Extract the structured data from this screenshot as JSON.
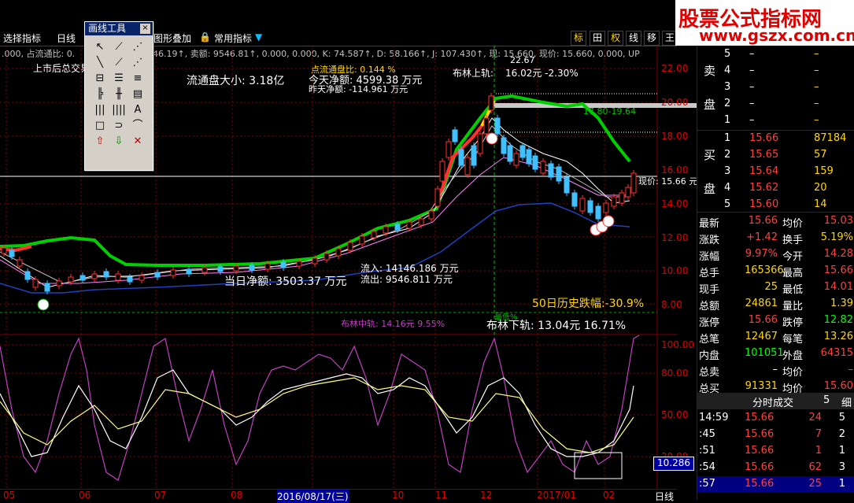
{
  "info_bar": {
    "text": ".000, 占流通比: 0.",
    "text2": "46.19↑, 卖额: 9546.81↑, 0.000, 0.000, K: 74.587↑, D: 58.166↑, J: 107.430↑, 现: 15.660, 现价: 15.660, 0.000, UP",
    "hidden_label": "上市后总交易"
  },
  "toolbar": {
    "select_indicator": "选择指标",
    "daily": "日线",
    "overlay": "图形叠加",
    "common_indicator": "常用指标",
    "right_buttons": [
      "标",
      "田",
      "权",
      "线",
      "移",
      "王"
    ]
  },
  "draw_tool": {
    "title": "画线工具",
    "close": "×",
    "tools": [
      "↖",
      "⟋",
      "⋰",
      "╲",
      "⟋",
      "⋰",
      "⊟",
      "☰",
      "≡",
      "╠",
      "╫",
      "▤",
      "|||",
      "||||",
      "A",
      "□",
      "⊃",
      "⌒",
      "⇧",
      "⇩",
      "✕"
    ]
  },
  "annotations": {
    "float_cap": "流通盘大小: 3.18亿",
    "float_pct_label": "点流通盘比: 0.144 %",
    "today_net": "今天净额: 4599.38 万元",
    "yesterday_net": "昨天净额: -114.961 万元",
    "boll_upper_label": "布林上轨:",
    "boll_upper_value": "16.02元  -2.30%",
    "price_high": "22.67",
    "range_label": "17.80-19.64",
    "current_price": "现价: 15.66 元",
    "inflow": "流入: 14146.186 万元",
    "outflow": "流出: 9546.811 万元",
    "day_net": "当日净额: 3503.37 万元",
    "hist_drop": "50日历史跌幅:-30.9%",
    "boll_mid": "布林中轨: 14.16元  9.55%",
    "boll_low": "布林下轨:  13.04元  16.71%",
    "lowest": "最低%"
  },
  "price_axis": [
    "22.00",
    "20.00",
    "18.00",
    "16.00",
    "14.00",
    "12.00",
    "10.00",
    "8.00"
  ],
  "osc_axis": [
    "100.00",
    "80.00",
    "50.00",
    "20.00"
  ],
  "osc_value_box": "10.286",
  "date_ticks": [
    "05",
    "06",
    "07",
    "08",
    "2016/08/17(三)",
    "10",
    "11",
    "12",
    "2017/01",
    "02",
    "日线"
  ],
  "watermark": {
    "line1": "股票公式指标网",
    "line2": "www.gszx.com.cn"
  },
  "order_book": {
    "sell_label": [
      "卖",
      "盘"
    ],
    "buy_label": [
      "买",
      "盘"
    ],
    "sell": [
      {
        "n": "5",
        "p": "–",
        "v": "–"
      },
      {
        "n": "4",
        "p": "–",
        "v": "–"
      },
      {
        "n": "3",
        "p": "–",
        "v": "–"
      },
      {
        "n": "2",
        "p": "–",
        "v": "–"
      },
      {
        "n": "1",
        "p": "–",
        "v": "–"
      }
    ],
    "buy": [
      {
        "n": "1",
        "p": "15.66",
        "v": "87184"
      },
      {
        "n": "2",
        "p": "15.65",
        "v": "57"
      },
      {
        "n": "3",
        "p": "15.64",
        "v": "159"
      },
      {
        "n": "4",
        "p": "15.62",
        "v": "20"
      },
      {
        "n": "5",
        "p": "15.60",
        "v": "14"
      }
    ]
  },
  "stats": [
    {
      "l1": "最新",
      "v1": "15.66",
      "l2": "均价",
      "v2": "15.03"
    },
    {
      "l1": "涨跌",
      "v1": "+1.42",
      "l2": "换手",
      "v2": "5.19%"
    },
    {
      "l1": "涨幅",
      "v1": "9.97%",
      "l2": "今开",
      "v2": "14.28"
    },
    {
      "l1": "总手",
      "v1": "165366",
      "l2": "最高",
      "v2": "15.66"
    },
    {
      "l1": "现手",
      "v1": "25",
      "l2": "最低",
      "v2": "14.01"
    },
    {
      "l1": "总额",
      "v1": "24861",
      "l2": "量比",
      "v2": "1.39"
    },
    {
      "l1": "涨停",
      "v1": "15.66",
      "l2": "跌停",
      "v2": "12.82"
    },
    {
      "l1": "总笔",
      "v1": "12467",
      "l2": "每笔",
      "v2": "13.26"
    },
    {
      "l1": "内盘",
      "v1": "101051",
      "l2": "外盘",
      "v2": "64315"
    },
    {
      "l1": "总卖",
      "v1": "–",
      "l2": "均价",
      "v2": "–"
    },
    {
      "l1": "总买",
      "v1": "91331",
      "l2": "均价",
      "v2": "15.60"
    }
  ],
  "ticks_header": {
    "label": "分时成交",
    "btn1": "5",
    "btn2": "细"
  },
  "ticks": [
    {
      "t": "14:59",
      "p": "15.66",
      "v": "24",
      "n": "5"
    },
    {
      "t": ":45",
      "p": "15.66",
      "v": "7",
      "n": "2"
    },
    {
      "t": ":51",
      "p": "15.66",
      "v": "1",
      "n": "1"
    },
    {
      "t": ":54",
      "p": "15.66",
      "v": "62",
      "n": "3"
    },
    {
      "t": ":57",
      "p": "15.66",
      "v": "25",
      "n": "1"
    }
  ]
}
